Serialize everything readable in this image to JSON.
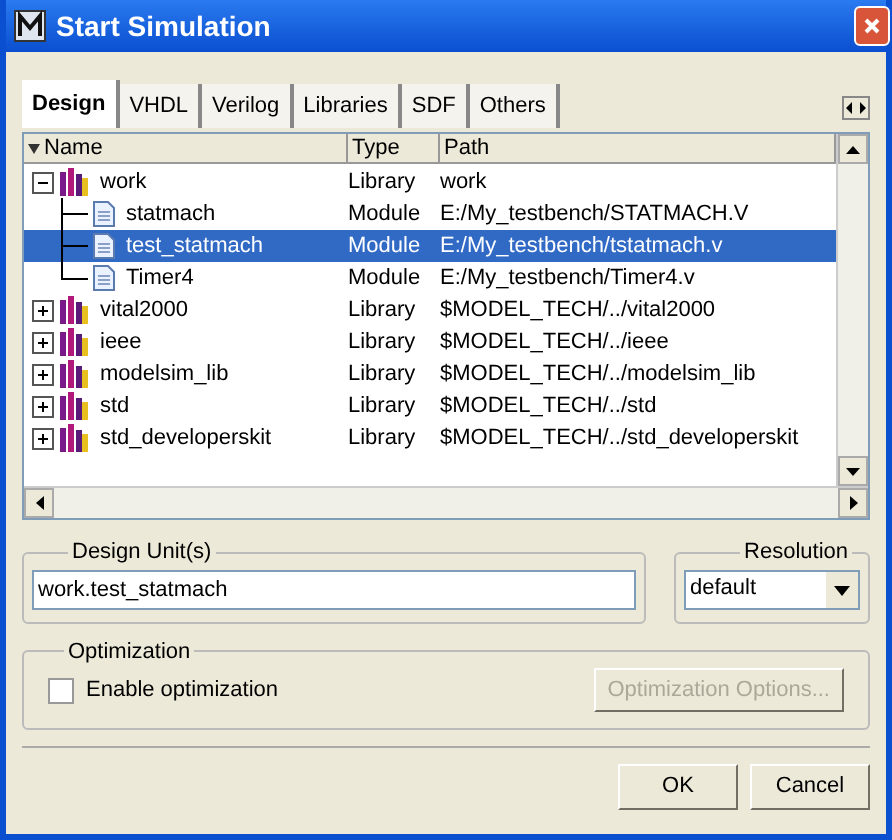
{
  "window": {
    "title": "Start Simulation"
  },
  "tabs": [
    {
      "label": "Design",
      "selected": true
    },
    {
      "label": "VHDL",
      "selected": false
    },
    {
      "label": "Verilog",
      "selected": false
    },
    {
      "label": "Libraries",
      "selected": false
    },
    {
      "label": "SDF",
      "selected": false
    },
    {
      "label": "Others",
      "selected": false
    }
  ],
  "table": {
    "columns": [
      "Name",
      "Type",
      "Path"
    ],
    "rows": [
      {
        "kind": "library",
        "name": "work",
        "type": "Library",
        "path": "work",
        "expanded": true,
        "selected": false,
        "children": [
          {
            "kind": "module",
            "name": "statmach",
            "type": "Module",
            "path": "E:/My_testbench/STATMACH.V",
            "selected": false
          },
          {
            "kind": "module",
            "name": "test_statmach",
            "type": "Module",
            "path": "E:/My_testbench/tstatmach.v",
            "selected": true
          },
          {
            "kind": "module",
            "name": "Timer4",
            "type": "Module",
            "path": "E:/My_testbench/Timer4.v",
            "selected": false
          }
        ]
      },
      {
        "kind": "library",
        "name": "vital2000",
        "type": "Library",
        "path": "$MODEL_TECH/../vital2000",
        "expanded": false,
        "selected": false
      },
      {
        "kind": "library",
        "name": "ieee",
        "type": "Library",
        "path": "$MODEL_TECH/../ieee",
        "expanded": false,
        "selected": false
      },
      {
        "kind": "library",
        "name": "modelsim_lib",
        "type": "Library",
        "path": "$MODEL_TECH/../modelsim_lib",
        "expanded": false,
        "selected": false
      },
      {
        "kind": "library",
        "name": "std",
        "type": "Library",
        "path": "$MODEL_TECH/../std",
        "expanded": false,
        "selected": false
      },
      {
        "kind": "library",
        "name": "std_developerskit",
        "type": "Library",
        "path": "$MODEL_TECH/../std_developerskit",
        "expanded": false,
        "selected": false
      }
    ]
  },
  "design_units": {
    "label": "Design Unit(s)",
    "value": "work.test_statmach"
  },
  "resolution": {
    "label": "Resolution",
    "value": "default"
  },
  "optimization": {
    "label": "Optimization",
    "checkbox": {
      "label": "Enable optimization",
      "checked": false
    },
    "options_button": {
      "label": "Optimization Options...",
      "disabled": true
    }
  },
  "buttons": [
    "OK",
    "Cancel"
  ]
}
